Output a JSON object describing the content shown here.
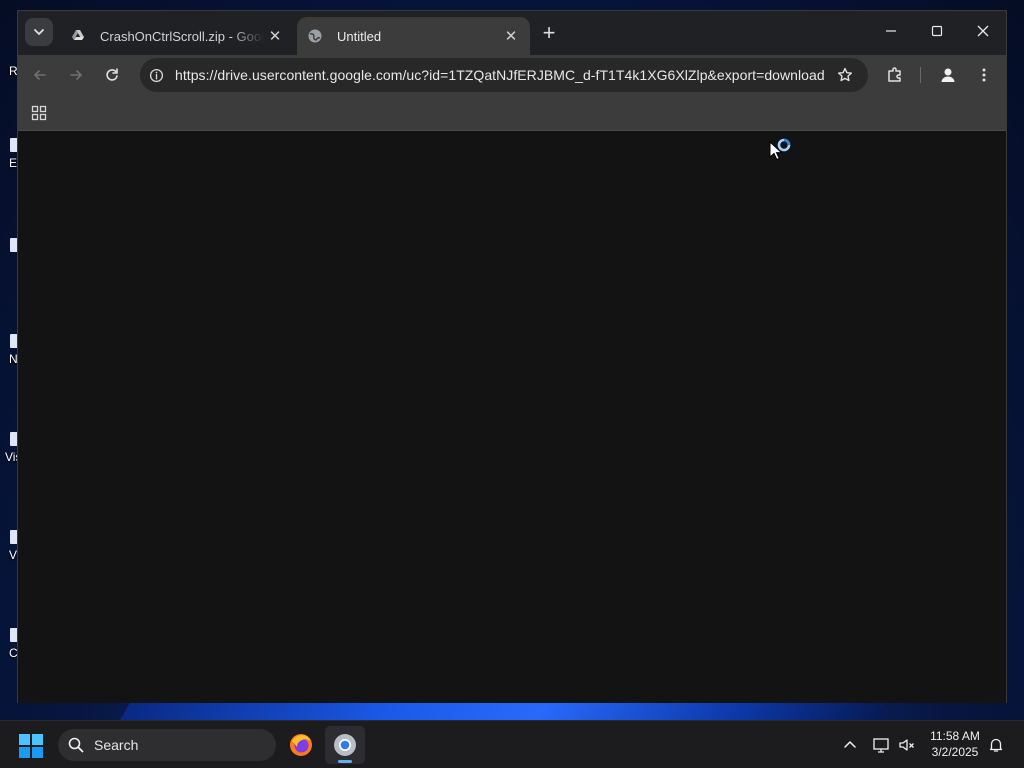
{
  "desktop": {
    "icons": [
      {
        "label": "R"
      },
      {
        "label": "E"
      },
      {
        "label": ""
      },
      {
        "label": "N"
      },
      {
        "label": "Vis"
      },
      {
        "label": "V"
      },
      {
        "label": "C"
      }
    ]
  },
  "browser": {
    "tabs": [
      {
        "title": "CrashOnCtrlScroll.zip - Google Drive",
        "favicon": "drive-icon",
        "active": false
      },
      {
        "title": "Untitled",
        "favicon": "globe-icon",
        "active": true
      }
    ],
    "new_tab_label": "+",
    "address_bar": {
      "url": "https://drive.usercontent.google.com/uc?id=1TZQatNJfERJBMC_d-fT1T4k1XG6XlZlp&export=download"
    },
    "page_state": "loading"
  },
  "taskbar": {
    "search_label": "Search",
    "apps": [
      {
        "name": "firefox",
        "active": false
      },
      {
        "name": "chrome",
        "active": true
      }
    ],
    "clock": {
      "time": "11:58 AM",
      "date": "3/2/2025"
    }
  },
  "colors": {
    "tabstrip": "#202124",
    "toolbar": "#3c3c3c",
    "content_bg": "#131313",
    "taskbar": "#1c1c1f",
    "accent": "#60b0f0"
  }
}
